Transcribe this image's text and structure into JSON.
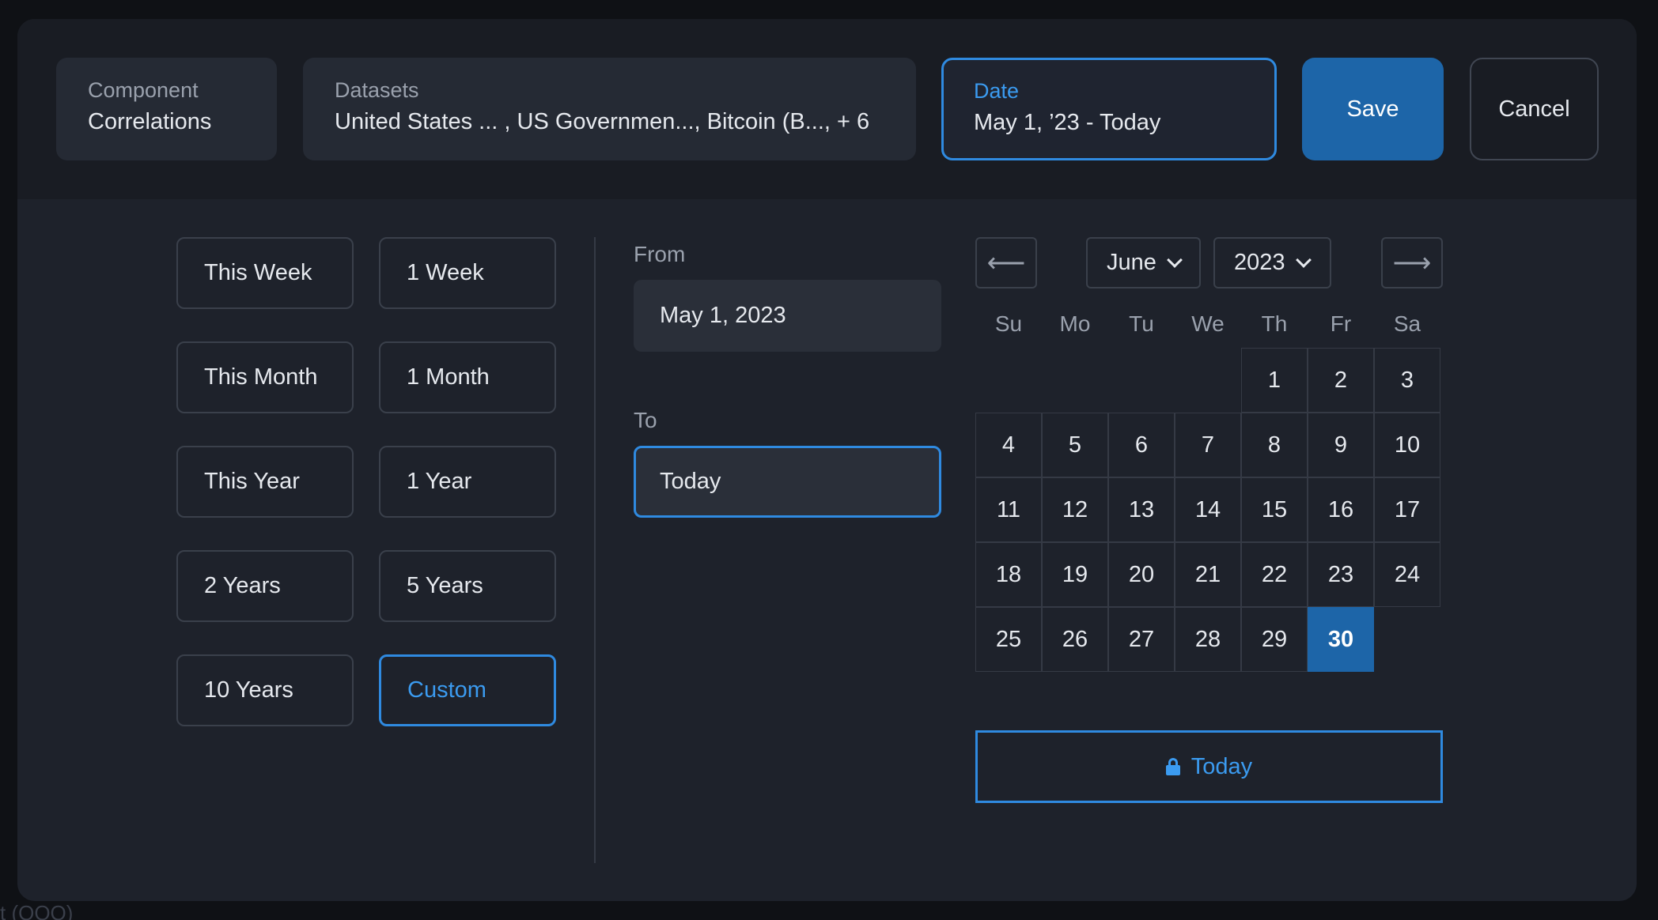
{
  "header": {
    "component": {
      "label": "Component",
      "value": "Correlations"
    },
    "datasets": {
      "label": "Datasets",
      "value": "United States ... , US Governmen..., Bitcoin (B..., + 6"
    },
    "date": {
      "label": "Date",
      "value": "May 1, ’23 - Today"
    },
    "save_label": "Save",
    "cancel_label": "Cancel"
  },
  "presets": [
    {
      "label": "This Week",
      "active": false
    },
    {
      "label": "1 Week",
      "active": false
    },
    {
      "label": "This Month",
      "active": false
    },
    {
      "label": "1 Month",
      "active": false
    },
    {
      "label": "This Year",
      "active": false
    },
    {
      "label": "1 Year",
      "active": false
    },
    {
      "label": "2 Years",
      "active": false
    },
    {
      "label": "5 Years",
      "active": false
    },
    {
      "label": "10 Years",
      "active": false
    },
    {
      "label": "Custom",
      "active": true
    }
  ],
  "range": {
    "from_label": "From",
    "from_value": "May 1, 2023",
    "to_label": "To",
    "to_value": "Today"
  },
  "calendar": {
    "prev_icon": "arrow-left-icon",
    "next_icon": "arrow-right-icon",
    "prev_glyph": "⟵",
    "next_glyph": "⟶",
    "month": "June",
    "year": "2023",
    "weekdays": [
      "Su",
      "Mo",
      "Tu",
      "We",
      "Th",
      "Fr",
      "Sa"
    ],
    "first_weekday_index": 4,
    "days_in_month": 30,
    "selected_day": 30
  },
  "today_button": {
    "label": "Today",
    "icon": "lock-icon"
  },
  "colors": {
    "accent": "#2f8ae0",
    "primary_button": "#1d65a8",
    "modal_bg": "#1e222b"
  }
}
